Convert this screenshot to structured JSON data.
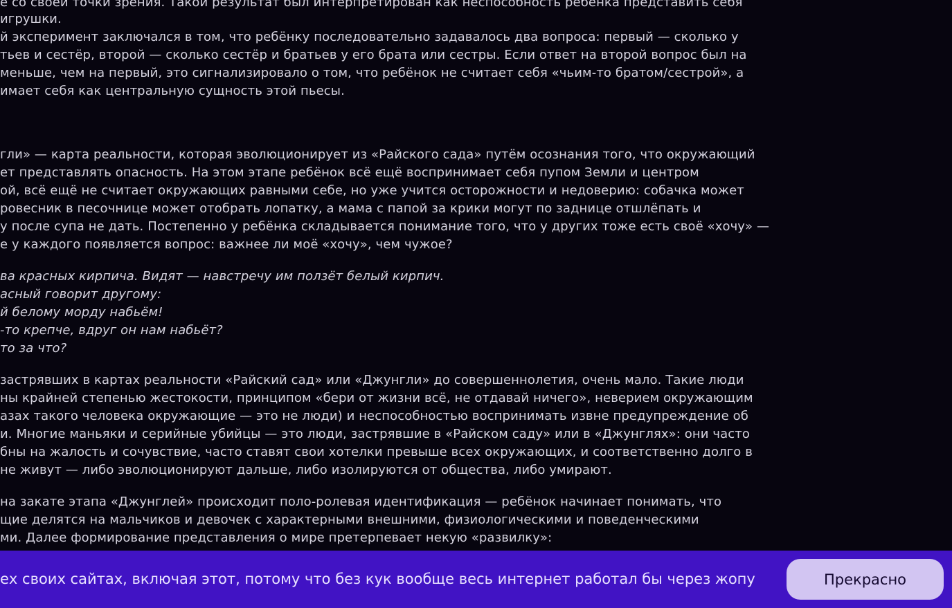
{
  "article": {
    "lines": [
      "е со своей точки зрения. Такой результат был интерпретирован как неспособность ребёнка представить себя",
      "игрушки.",
      "й эксперимент заключался в том, что ребёнку последовательно задавалось два вопроса: первый — сколько у",
      "тьев и сестёр, второй — сколько сестёр и братьев у его брата или сестры. Если ответ на второй вопрос был на",
      "меньше, чем на первый, это сигнализировало о том, что ребёнок не считает себя «чьим-то братом/сестрой», а",
      "имает себя как центральную сущность этой пьесы.",
      "гли» — карта реальности, которая эволюционирует из «Райского сада» путём осознания того, что окружающий",
      "ет представлять опасность. На этом этапе ребёнок всё ещё воспринимает себя пупом Земли и центром",
      "ой, всё ещё не считает окружающих равными себе, но уже учится осторожности и недоверию: собачка может",
      "ровесник в песочнице может отобрать лопатку, а мама с папой за крики могут по заднице отшлёпать и",
      "у после супа не дать. Постепенно у ребёнка складывается понимание того, что у других тоже есть своё «хочу» —",
      "е у каждого появляется вопрос: важнее ли моё «хочу», чем чужое?",
      "ва красных кирпича. Видят — навстречу им ползёт белый кирпич.",
      "асный говорит другому:",
      "й белому морду набьём!",
      "-то крепче, вдруг он нам набьёт?",
      "то за что?",
      "застрявших в картах реальности «Райский сад» или «Джунгли» до совершеннолетия, очень мало. Такие люди",
      "ны крайней степенью жестокости, принципом «бери от жизни всё, не отдавай ничего», неверием окружающим",
      "азах такого человека окружающие — это не люди) и неспособностью воспринимать извне предупреждение об",
      "и. Многие маньяки и серийные убийцы — это люди, застрявшие в «Райском саду» или в «Джунглях»: они часто",
      "бны на жалость и сочувствие, часто ставят свои хотелки превыше всех окружающих, и соответственно долго в",
      "не живут — либо эволюционируют дальше, либо изолируются от общества, либо умирают.",
      "на закате этапа «Джунглей» происходит поло-ролевая идентификация — ребёнок начинает понимать, что",
      "щие делятся на мальчиков и девочек с характерными внешними, физиологическими и поведенческими",
      "ми. Далее формирование представления о мире претерпевает некую «развилку»:"
    ]
  },
  "cookie_bar": {
    "text": "ех своих сайтах, включая этот, потому что без кук вообще весь интернет работал бы через жопу",
    "button_label": "Прекрасно"
  },
  "colors": {
    "background": "#07050f",
    "text": "#d4d2de",
    "cookie_bar": "#4113c4",
    "button": "#d2c5f2"
  }
}
